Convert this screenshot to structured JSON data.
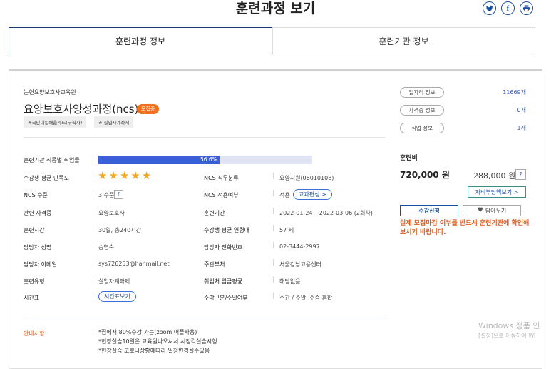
{
  "page": {
    "title": "훈련과정 보기"
  },
  "share": {
    "twitter": "twitter-icon",
    "facebook": "facebook-icon",
    "print": "print-icon"
  },
  "tabs": [
    {
      "label": "훈련과정 정보"
    },
    {
      "label": "훈련기관 정보"
    }
  ],
  "course": {
    "institution": "논현요양보호사교육원",
    "name": "요양보호사양성과정(ncs)",
    "status_badge": "모집중",
    "tags": [
      "#국민내일배움카드(구직자)",
      "# 실업자계좌제"
    ]
  },
  "info": {
    "employment_rate_label": "훈련기관 직종별 취업률",
    "employment_rate": "56.6%",
    "employment_rate_value": 56.6,
    "satisfaction_label": "수강생 평균 만족도",
    "satisfaction_stars": 5,
    "ncs_category_label": "NCS 직무분류",
    "ncs_category": "요양지원(06010108)",
    "ncs_level_label": "NCS 수준",
    "ncs_level": "3 수준",
    "ncs_level_help": "?",
    "ncs_applied_label": "NCS 적용여부",
    "ncs_applied": "적용",
    "curriculum_button": "교과편성 >",
    "cert_label": "관련 자격증",
    "cert": "요양보호사",
    "period_label": "훈련기간",
    "period": "2022-01-24 ~2022-03-06 (2회차)",
    "hours_label": "훈련시간",
    "hours": "30일, 총240시간",
    "avg_age_label": "수강생 평균 연령대",
    "avg_age": "57 세",
    "manager_label": "담당자 성명",
    "manager": "송영숙",
    "phone_label": "담당자 전화번호",
    "phone": "02-3444-2997",
    "email_label": "담당자 이메일",
    "email": "sys726253@hanmail.net",
    "agency_label": "주관부처",
    "agency": "서울강남고용센터",
    "type_label": "훈련유형",
    "type": "실업자계좌제",
    "wage_label": "취업처 임금평균",
    "wage": "해당없음",
    "timetable_label": "시간표",
    "timetable_button": "시간표보기",
    "daytype_label": "주야구분/주말여부",
    "daytype": "주간 / 주말, 주중 혼합"
  },
  "notice": {
    "label": "안내사항",
    "lines": [
      "*집에서 80%수강 가능(zoom 어플사용)",
      "*현장실습10일은 교육원나오셔서 시청각실습시행",
      "*현장실습 코로나상황에따라 일정변경될수있음"
    ]
  },
  "side": {
    "jobs_label": "일자리 정보",
    "jobs_count": "11669개",
    "cert_label": "자격증 정보",
    "cert_count": "0개",
    "occupation_label": "직업 정보",
    "occupation_count": "1개",
    "fee_label": "훈련비",
    "fee": "720,000 원",
    "self_pay": "288,000 원",
    "help": "?",
    "self_pay_button": "자비부담액보기 >",
    "apply_button": "수강신청",
    "save_button": "담아두기",
    "warning": "실제 모집마감 여부를 반드시 훈련기관에 확인해보시기 바랍니다."
  },
  "watermark": {
    "line1": "Windows 정품 인",
    "line2": "[설정]으로 이동하여 Wi"
  }
}
